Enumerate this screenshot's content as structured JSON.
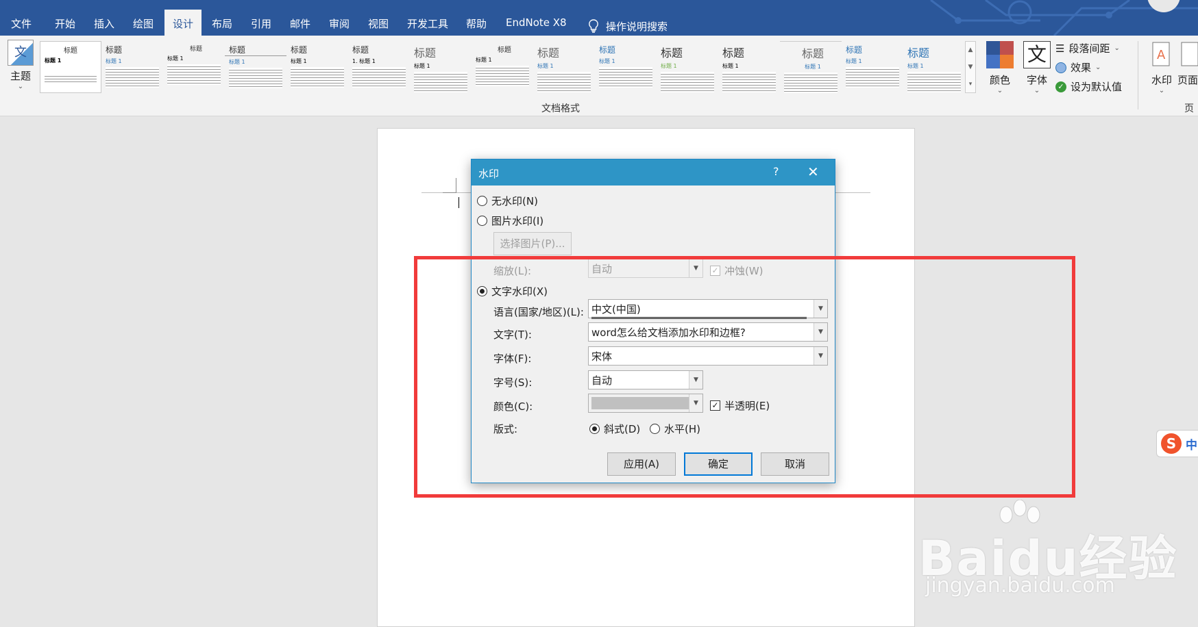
{
  "ribbon": {
    "tabs": [
      "文件",
      "开始",
      "插入",
      "绘图",
      "设计",
      "布局",
      "引用",
      "邮件",
      "审阅",
      "视图",
      "开发工具",
      "帮助",
      "EndNote X8"
    ],
    "active_tab": "设计",
    "tell_me": "操作说明搜索",
    "theme_label": "主题",
    "gallery_group_label": "文档格式",
    "gallery_items": [
      {
        "title": "标题",
        "sub": "标题 1"
      },
      {
        "title": "标题",
        "sub": "标题 1"
      },
      {
        "title": "标题",
        "sub": "标题 1"
      },
      {
        "title": "标题",
        "sub": "标题 1"
      },
      {
        "title": "标题",
        "sub": "标题 1"
      },
      {
        "title": "标题",
        "sub": "1. 标题 1"
      },
      {
        "title": "标题",
        "sub": "标题 1"
      },
      {
        "title": "标题",
        "sub": "标题 1"
      },
      {
        "title": "标题",
        "sub": "标题 1"
      },
      {
        "title": "标题",
        "sub": "标题 1"
      },
      {
        "title": "标题",
        "sub": "标题 1"
      },
      {
        "title": "标题",
        "sub": "标题 1"
      },
      {
        "title": "标题",
        "sub": "标题 1"
      },
      {
        "title": "标题",
        "sub": "标题 1"
      },
      {
        "title": "标题",
        "sub": "标题 1"
      }
    ],
    "colors_label": "颜色",
    "fonts_label": "字体",
    "paragraph_spacing_label": "段落间距",
    "effects_label": "效果",
    "set_default_label": "设为默认值",
    "watermark_label": "水印",
    "page_color_label": "页面",
    "page_group_label": "页"
  },
  "dialog": {
    "title": "水印",
    "help": "?",
    "close": "✕",
    "no_watermark": "无水印(N)",
    "picture_watermark": "图片水印(I)",
    "select_picture": "选择图片(P)...",
    "scale_label": "缩放(L):",
    "scale_value": "自动",
    "washout_label": "冲蚀(W)",
    "text_watermark": "文字水印(X)",
    "language_label": "语言(国家/地区)(L):",
    "language_value": "中文(中国)",
    "text_label": "文字(T):",
    "text_value": "word怎么给文档添加水印和边框?",
    "font_label": "字体(F):",
    "font_value": "宋体",
    "size_label": "字号(S):",
    "size_value": "自动",
    "color_label": "颜色(C):",
    "color_value": "#c0c0c0",
    "semitransparent_label": "半透明(E)",
    "layout_label": "版式:",
    "diagonal_label": "斜式(D)",
    "horizontal_label": "水平(H)",
    "apply_button": "应用(A)",
    "ok_button": "确定",
    "cancel_button": "取消"
  },
  "ime": {
    "logo": "S",
    "mode": "中"
  },
  "watermark_overlay": {
    "brand": "Baidu经验",
    "url": "jingyan.baidu.com"
  },
  "colors": {
    "ribbon_blue": "#2b579a",
    "dialog_title": "#2e95c6",
    "highlight": "#f13b3b"
  }
}
